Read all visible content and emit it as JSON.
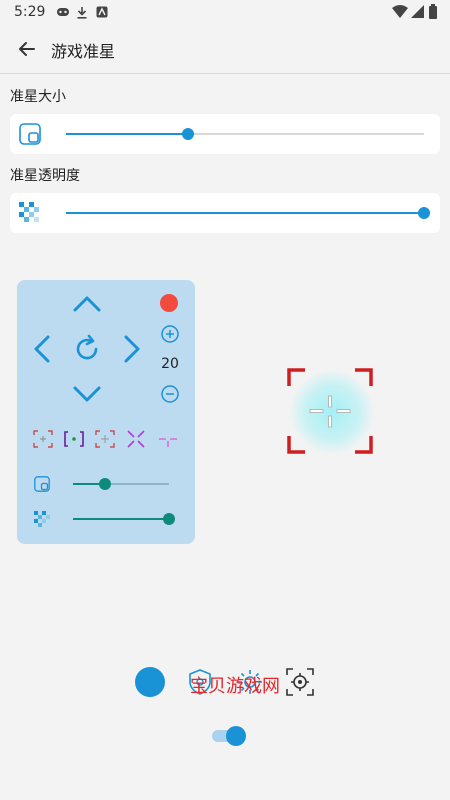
{
  "status_bar": {
    "time": "5:29"
  },
  "app_bar": {
    "title": "游戏准星"
  },
  "size_section": {
    "label": "准星大小",
    "value_fraction": 0.34
  },
  "opacity_section": {
    "label": "准星透明度",
    "value_fraction": 1.0
  },
  "control_panel": {
    "counter_value": "20",
    "panel_size_fraction": 0.33,
    "panel_opacity_fraction": 1.0
  },
  "bottom": {
    "watermark": "宝贝游戏网",
    "toggle_on": true
  },
  "colors": {
    "accent": "#1a93d6",
    "record": "#f24a3c",
    "panel": "#bcdaf0",
    "teal": "#0e8a7c",
    "crosshair_frame": "#cc1f1f"
  }
}
